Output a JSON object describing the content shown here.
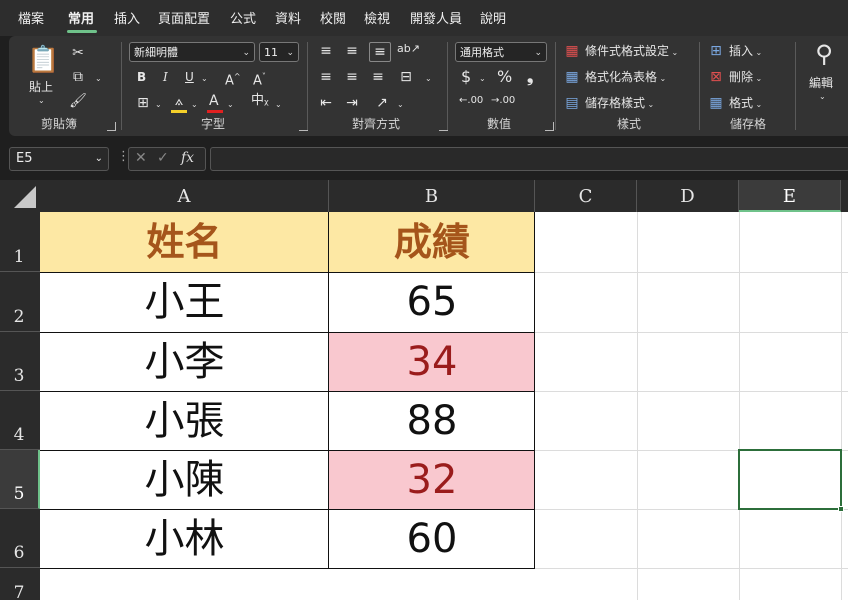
{
  "menu": [
    "檔案",
    "常用",
    "插入",
    "頁面配置",
    "公式",
    "資料",
    "校閱",
    "檢視",
    "開發人員",
    "說明"
  ],
  "ribbon": {
    "clipboard": {
      "paste": "貼上",
      "label": "剪貼簿"
    },
    "font": {
      "name": "新細明體",
      "size": "11",
      "bold": "B",
      "italic": "I",
      "underline": "U",
      "grow": "A^",
      "shrink": "A˅",
      "label": "字型",
      "font_color": "#e02020",
      "fill_color": "#f5d02a"
    },
    "alignment": {
      "label": "對齊方式"
    },
    "number": {
      "format": "通用格式",
      "currency": "$",
      "percent": "%",
      "comma": "❟",
      "inc_decimal": ".00",
      "dec_decimal": ".00",
      "label": "數值"
    },
    "styles": {
      "conditional": "條件式格式設定",
      "table": "格式化為表格",
      "cell_styles": "儲存格樣式",
      "label": "樣式"
    },
    "cells": {
      "insert": "插入",
      "delete": "刪除",
      "format": "格式",
      "label": "儲存格"
    },
    "editing": {
      "label": "編輯"
    }
  },
  "formula_bar": {
    "name_box": "E5",
    "fx": "fx",
    "content": ""
  },
  "columns": [
    "A",
    "B",
    "C",
    "D",
    "E"
  ],
  "rows": [
    "1",
    "2",
    "3",
    "4",
    "5",
    "6",
    "7"
  ],
  "selected_cell": "E5",
  "table": {
    "header": {
      "name": "姓名",
      "score": "成績"
    },
    "rows": [
      {
        "name": "小王",
        "score": "65",
        "low": false
      },
      {
        "name": "小李",
        "score": "34",
        "low": true
      },
      {
        "name": "小張",
        "score": "88",
        "low": false
      },
      {
        "name": "小陳",
        "score": "32",
        "low": true
      },
      {
        "name": "小林",
        "score": "60",
        "low": false
      }
    ]
  },
  "colors": {
    "header_fill": "#fde8a4",
    "header_text": "#a5551b",
    "low_fill": "#f9c8cf",
    "low_text": "#9a1c1c",
    "accent": "#6fc28a",
    "selection": "#2c6e3a"
  }
}
